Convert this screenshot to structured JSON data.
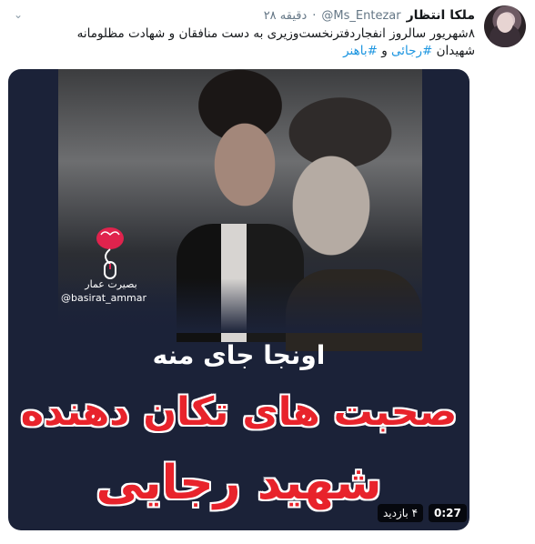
{
  "tweet": {
    "display_name": "ملکا انتظار",
    "handle": "@Ms_Entezar",
    "separator": "·",
    "time": "۲۸ دقیقه",
    "text_line1": "۸شهریور سالروز انفجاردفترنخست‌وزیری به دست منافقان و شهادت مظلومانه",
    "text_line2_prefix": "شهیدان",
    "hashtag1": "#رجائی",
    "conjunction": "و",
    "hashtag2": "#باهنر"
  },
  "media": {
    "logo_name_fa": "بصیرت عمار",
    "logo_handle": "@basirat_ammar",
    "subtitle": "اونجا جای منه",
    "title_line1": "صحبت های تکان دهنده",
    "title_line2": "شهید رجایی",
    "duration": "0:27",
    "views": "۴ بازدید"
  },
  "colors": {
    "hashtag": "#1b95e0",
    "title_red": "#e8232b",
    "media_bg": "#1b2238"
  },
  "icons": {
    "caret": "chevron-down-icon",
    "logo": "brain-mouse-icon"
  }
}
